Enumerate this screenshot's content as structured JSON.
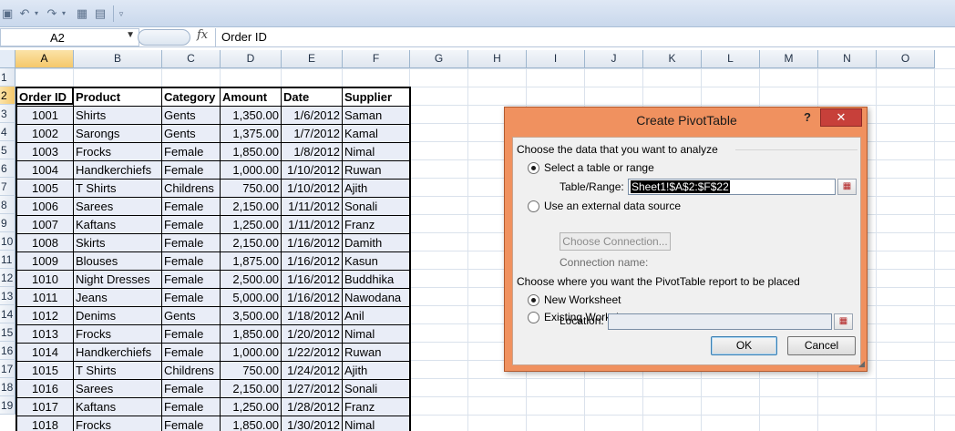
{
  "formula_bar": {
    "name_box": "A2",
    "fx_label": "fx",
    "content": "Order ID"
  },
  "columns": [
    "A",
    "B",
    "C",
    "D",
    "E",
    "F",
    "G",
    "H",
    "I",
    "J",
    "K",
    "L",
    "M",
    "N",
    "O"
  ],
  "rows": [
    "1",
    "2",
    "3",
    "4",
    "5",
    "6",
    "7",
    "8",
    "9",
    "10",
    "11",
    "12",
    "13",
    "14",
    "15",
    "16",
    "17",
    "18",
    "19"
  ],
  "table": {
    "headers": [
      "Order ID",
      "Product",
      "Category",
      "Amount",
      "Date",
      "Supplier"
    ],
    "rows": [
      [
        "1001",
        "Shirts",
        "Gents",
        "1,350.00",
        "1/6/2012",
        "Saman"
      ],
      [
        "1002",
        "Sarongs",
        "Gents",
        "1,375.00",
        "1/7/2012",
        "Kamal"
      ],
      [
        "1003",
        "Frocks",
        "Female",
        "1,850.00",
        "1/8/2012",
        "Nimal"
      ],
      [
        "1004",
        "Handkerchiefs",
        "Female",
        "1,000.00",
        "1/10/2012",
        "Ruwan"
      ],
      [
        "1005",
        "T Shirts",
        "Childrens",
        "750.00",
        "1/10/2012",
        "Ajith"
      ],
      [
        "1006",
        "Sarees",
        "Female",
        "2,150.00",
        "1/11/2012",
        "Sonali"
      ],
      [
        "1007",
        "Kaftans",
        "Female",
        "1,250.00",
        "1/11/2012",
        "Franz"
      ],
      [
        "1008",
        "Skirts",
        "Female",
        "2,150.00",
        "1/16/2012",
        "Damith"
      ],
      [
        "1009",
        "Blouses",
        "Female",
        "1,875.00",
        "1/16/2012",
        "Kasun"
      ],
      [
        "1010",
        "Night Dresses",
        "Female",
        "2,500.00",
        "1/16/2012",
        "Buddhika"
      ],
      [
        "1011",
        "Jeans",
        "Female",
        "5,000.00",
        "1/16/2012",
        "Nawodana"
      ],
      [
        "1012",
        "Denims",
        "Gents",
        "3,500.00",
        "1/18/2012",
        "Anil"
      ],
      [
        "1013",
        "Frocks",
        "Female",
        "1,850.00",
        "1/20/2012",
        "Nimal"
      ],
      [
        "1014",
        "Handkerchiefs",
        "Female",
        "1,000.00",
        "1/22/2012",
        "Ruwan"
      ],
      [
        "1015",
        "T Shirts",
        "Childrens",
        "750.00",
        "1/24/2012",
        "Ajith"
      ],
      [
        "1016",
        "Sarees",
        "Female",
        "2,150.00",
        "1/27/2012",
        "Sonali"
      ],
      [
        "1017",
        "Kaftans",
        "Female",
        "1,250.00",
        "1/28/2012",
        "Franz"
      ],
      [
        "1018",
        "Frocks",
        "Female",
        "1,850.00",
        "1/30/2012",
        "Nimal"
      ]
    ]
  },
  "dialog": {
    "title": "Create PivotTable",
    "help": "?",
    "close": "✕",
    "section1": "Choose the data that you want to analyze",
    "opt_select_range": "Select a table or range",
    "table_range_label": "Table/Range:",
    "table_range_value": "Sheet1!$A$2:$F$22",
    "opt_external": "Use an external data source",
    "choose_connection": "Choose Connection...",
    "connection_name": "Connection name:",
    "section2": "Choose where you want the PivotTable report to be placed",
    "opt_new_ws": "New Worksheet",
    "opt_existing_ws": "Existing Worksheet",
    "location_label": "Location:",
    "location_value": "",
    "ok": "OK",
    "cancel": "Cancel"
  },
  "colors": {
    "dialog_frame": "#f0915f",
    "close_button": "#c7403a",
    "selected_header": "#f5c86a",
    "table_fill": "#e9edf7"
  },
  "icons": [
    "save-icon",
    "undo-icon",
    "redo-icon",
    "pivot-icon",
    "form-icon",
    "customize-qat-icon",
    "range-select-icon"
  ]
}
